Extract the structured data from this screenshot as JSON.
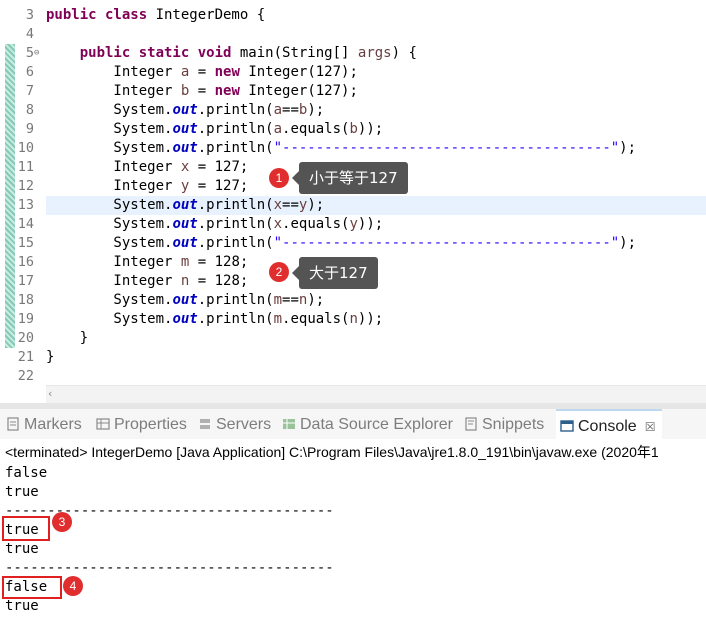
{
  "editor": {
    "lines": [
      {
        "num": "3",
        "tokens": [
          [
            "kw",
            "public class "
          ],
          [
            "",
            "IntegerDemo {"
          ]
        ]
      },
      {
        "num": "4",
        "tokens": []
      },
      {
        "num": "5",
        "tokens": [
          [
            "",
            "    "
          ],
          [
            "kw",
            "public static void "
          ],
          [
            "",
            "main(String[] "
          ],
          [
            "var",
            "args"
          ],
          [
            "",
            ") {"
          ]
        ]
      },
      {
        "num": "6",
        "tokens": [
          [
            "",
            "        Integer "
          ],
          [
            "var",
            "a"
          ],
          [
            "",
            " = "
          ],
          [
            "kw",
            "new "
          ],
          [
            "",
            "Integer(127);"
          ]
        ]
      },
      {
        "num": "7",
        "tokens": [
          [
            "",
            "        Integer "
          ],
          [
            "var",
            "b"
          ],
          [
            "",
            " = "
          ],
          [
            "kw",
            "new "
          ],
          [
            "",
            "Integer(127);"
          ]
        ]
      },
      {
        "num": "8",
        "tokens": [
          [
            "",
            "        System."
          ],
          [
            "out",
            "out"
          ],
          [
            "",
            ".println("
          ],
          [
            "var",
            "a"
          ],
          [
            "",
            "=="
          ],
          [
            "var",
            "b"
          ],
          [
            "",
            ");"
          ]
        ]
      },
      {
        "num": "9",
        "tokens": [
          [
            "",
            "        System."
          ],
          [
            "out",
            "out"
          ],
          [
            "",
            ".println("
          ],
          [
            "var",
            "a"
          ],
          [
            "",
            ".equals("
          ],
          [
            "var",
            "b"
          ],
          [
            "",
            "));"
          ]
        ]
      },
      {
        "num": "10",
        "tokens": [
          [
            "",
            "        System."
          ],
          [
            "out",
            "out"
          ],
          [
            "",
            ".println("
          ],
          [
            "str",
            "\"---------------------------------------\""
          ],
          [
            "",
            ");"
          ]
        ]
      },
      {
        "num": "11",
        "tokens": [
          [
            "",
            "        Integer "
          ],
          [
            "var",
            "x"
          ],
          [
            "",
            " = 127;"
          ]
        ]
      },
      {
        "num": "12",
        "tokens": [
          [
            "",
            "        Integer "
          ],
          [
            "var",
            "y"
          ],
          [
            "",
            " = 127;"
          ]
        ]
      },
      {
        "num": "13",
        "tokens": [
          [
            "",
            "        System."
          ],
          [
            "out",
            "out"
          ],
          [
            "",
            ".println("
          ],
          [
            "var",
            "x"
          ],
          [
            "",
            "=="
          ],
          [
            "var",
            "y"
          ],
          [
            "",
            ");"
          ]
        ],
        "highlight": true
      },
      {
        "num": "14",
        "tokens": [
          [
            "",
            "        System."
          ],
          [
            "out",
            "out"
          ],
          [
            "",
            ".println("
          ],
          [
            "var",
            "x"
          ],
          [
            "",
            ".equals("
          ],
          [
            "var",
            "y"
          ],
          [
            "",
            "));"
          ]
        ]
      },
      {
        "num": "15",
        "tokens": [
          [
            "",
            "        System."
          ],
          [
            "out",
            "out"
          ],
          [
            "",
            ".println("
          ],
          [
            "str",
            "\"---------------------------------------\""
          ],
          [
            "",
            ");"
          ]
        ]
      },
      {
        "num": "16",
        "tokens": [
          [
            "",
            "        Integer "
          ],
          [
            "var",
            "m"
          ],
          [
            "",
            " = 128;"
          ]
        ]
      },
      {
        "num": "17",
        "tokens": [
          [
            "",
            "        Integer "
          ],
          [
            "var",
            "n"
          ],
          [
            "",
            " = 128;"
          ]
        ]
      },
      {
        "num": "18",
        "tokens": [
          [
            "",
            "        System."
          ],
          [
            "out",
            "out"
          ],
          [
            "",
            ".println("
          ],
          [
            "var",
            "m"
          ],
          [
            "",
            "=="
          ],
          [
            "var",
            "n"
          ],
          [
            "",
            ");"
          ]
        ]
      },
      {
        "num": "19",
        "tokens": [
          [
            "",
            "        System."
          ],
          [
            "out",
            "out"
          ],
          [
            "",
            ".println("
          ],
          [
            "var",
            "m"
          ],
          [
            "",
            ".equals("
          ],
          [
            "var",
            "n"
          ],
          [
            "",
            "));"
          ]
        ]
      },
      {
        "num": "20",
        "tokens": [
          [
            "",
            "    }"
          ]
        ]
      },
      {
        "num": "21",
        "tokens": [
          [
            "",
            "}"
          ]
        ]
      },
      {
        "num": "22",
        "tokens": []
      }
    ],
    "fold_marker": "⊖",
    "scroll_left": "‹"
  },
  "callouts": {
    "c1": {
      "num": "1",
      "text": "小于等于127"
    },
    "c2": {
      "num": "2",
      "text": "大于127"
    },
    "c3": {
      "num": "3"
    },
    "c4": {
      "num": "4"
    }
  },
  "tabs": [
    {
      "label": "Markers",
      "icon": "markers-icon"
    },
    {
      "label": "Properties",
      "icon": "properties-icon"
    },
    {
      "label": "Servers",
      "icon": "servers-icon"
    },
    {
      "label": "Data Source Explorer",
      "icon": "data-source-icon"
    },
    {
      "label": "Snippets",
      "icon": "snippets-icon"
    },
    {
      "label": "Console",
      "icon": "console-icon",
      "active": true,
      "close": "☒"
    }
  ],
  "console": {
    "status": "<terminated> IntegerDemo [Java Application] C:\\Program Files\\Java\\jre1.8.0_191\\bin\\javaw.exe (2020年1",
    "output": [
      "false",
      "true",
      "---------------------------------------",
      "true",
      "true",
      "---------------------------------------",
      "false",
      "true"
    ]
  },
  "colors": {
    "keyword": "#7f0055",
    "field": "#0000c0",
    "variable": "#6a3e3e",
    "string": "#2a00ff",
    "badge": "#e02e2e",
    "bubble": "#545454",
    "line_highlight": "#e8f2fe"
  }
}
